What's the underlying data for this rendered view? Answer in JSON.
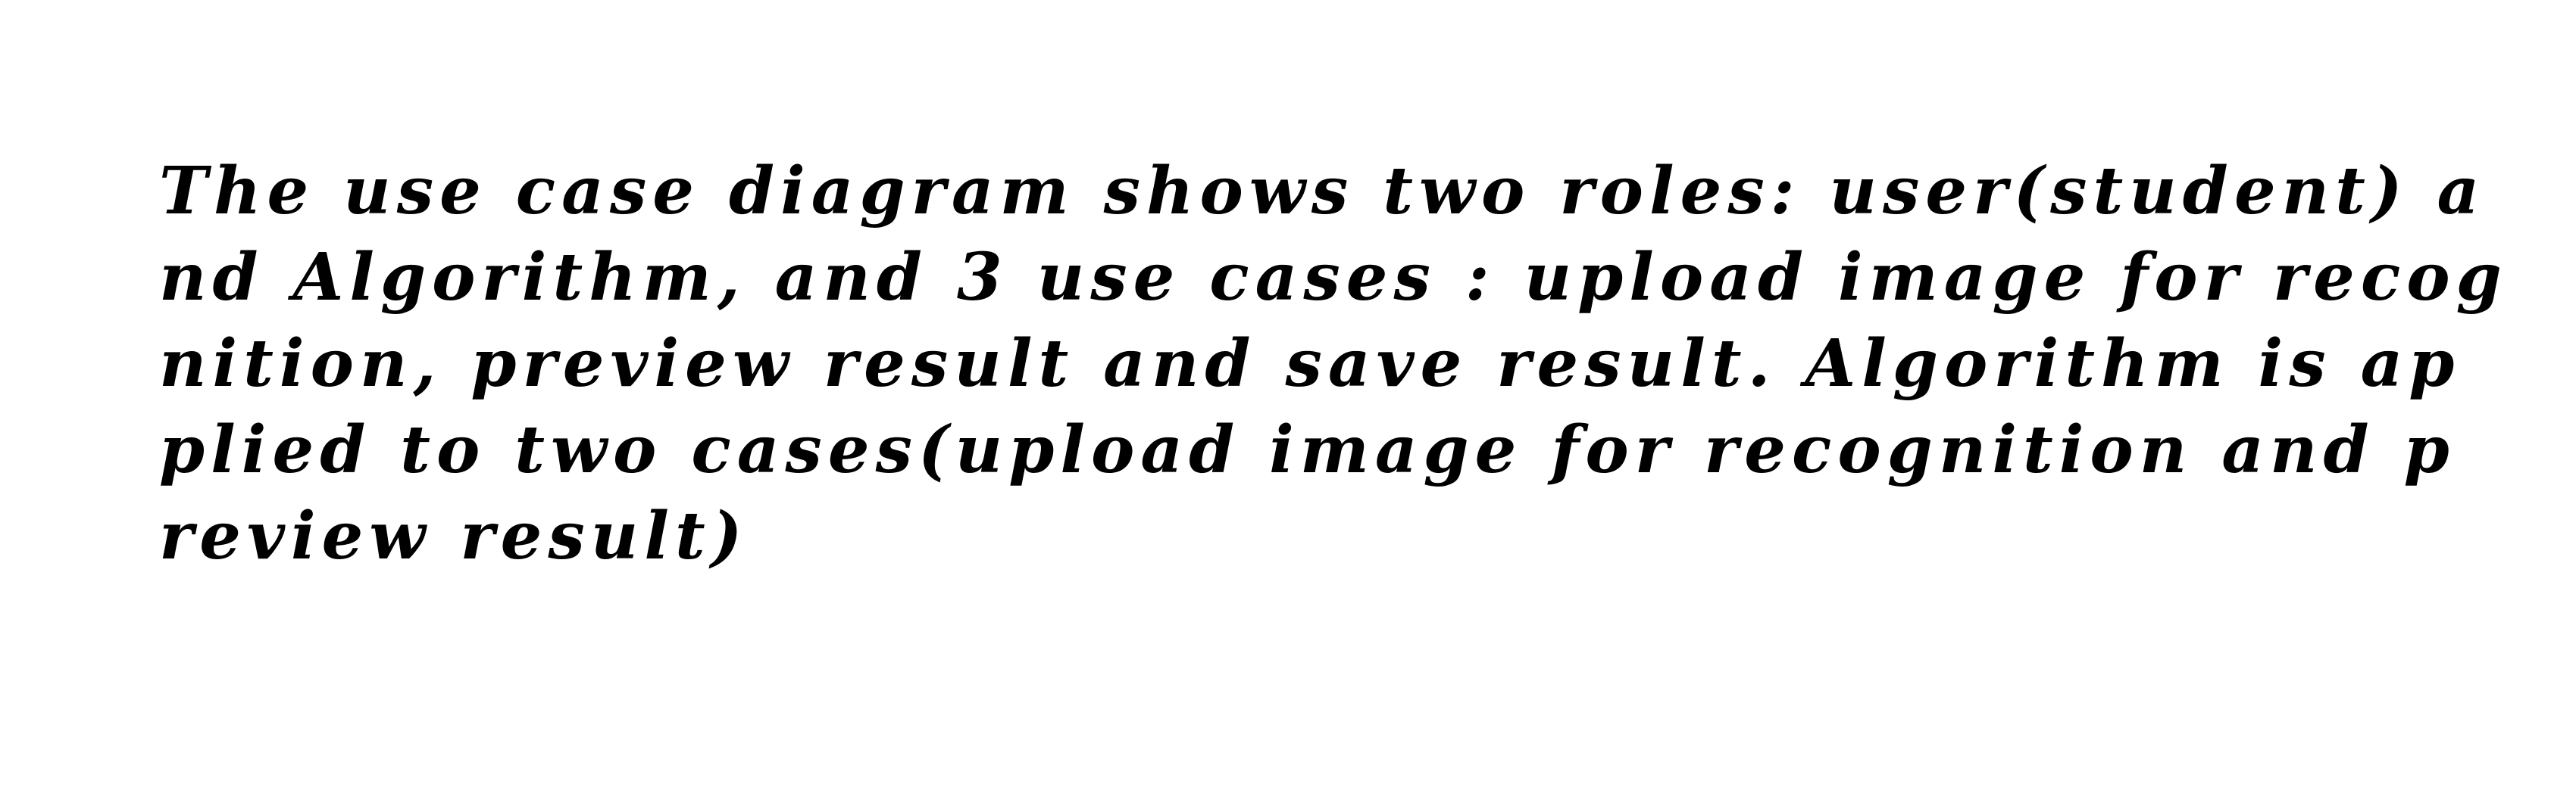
{
  "document": {
    "lines": [
      "The use case diagram shows two roles: user(student) a",
      "nd Algorithm, and 3 use cases : upload image for recog",
      "nition, preview result and save result. Algorithm is ap",
      "plied to two cases(upload image for recognition and p",
      "review result)"
    ]
  }
}
